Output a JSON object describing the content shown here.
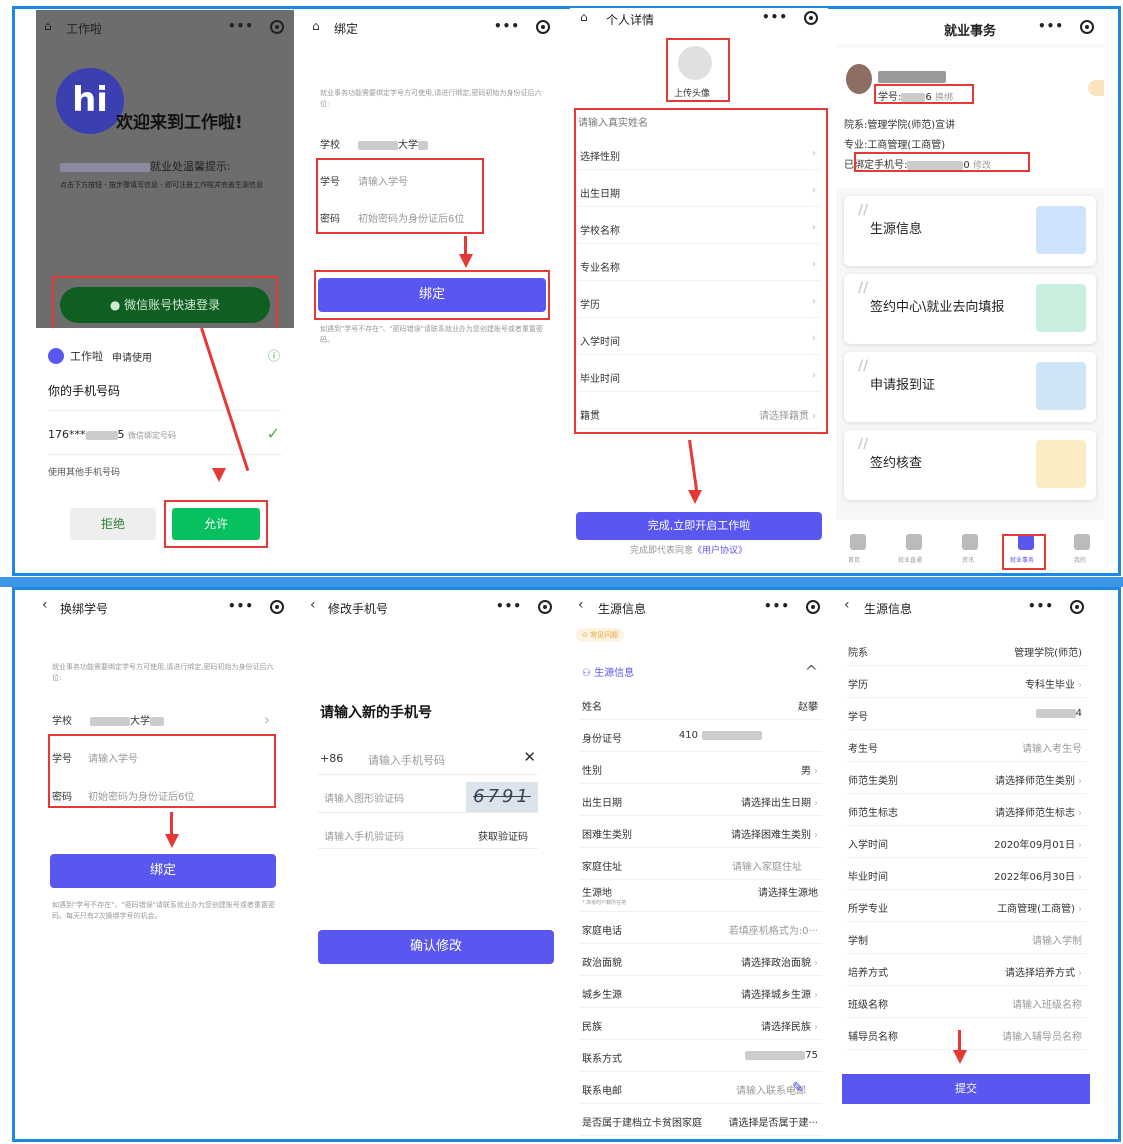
{
  "p1": {
    "header_title": "工作啦",
    "welcome": "欢迎来到工作啦!",
    "hi_logo": "hi",
    "notice_label": "就业处温馨提示:",
    "notice_text": "点击下方按钮 - 按步骤填写信息 - 即可注册工作啦并完善生源信息",
    "wechat_login": "微信账号快速登录",
    "sheet_app": "工作啦",
    "sheet_apply": "申请使用",
    "phone_question": "你的手机号码",
    "phone_masked": "176***",
    "phone_tail": "5",
    "phone_bound": "微信绑定号码",
    "other_phone": "使用其他手机号码",
    "reject": "拒绝",
    "allow": "允许"
  },
  "p2": {
    "header_title": "绑定",
    "desc": "就业事务功能需要绑定学号方可使用,请进行绑定,密码初始为身份证后六位:",
    "school_label": "学校",
    "school_value": "大学",
    "id_label": "学号",
    "id_placeholder": "请输入学号",
    "pwd_label": "密码",
    "pwd_placeholder": "初始密码为身份证后6位",
    "bind_button": "绑定",
    "hint": "如遇到\"学号不存在\"、\"密码错误\"请联系就业办为您创建账号或者重置密码。"
  },
  "p3": {
    "header_title": "个人详情",
    "upload_avatar": "上传头像",
    "name_placeholder": "请输入真实姓名",
    "rows": [
      {
        "k": "选择性别",
        "v": ""
      },
      {
        "k": "出生日期",
        "v": ""
      },
      {
        "k": "学校名称",
        "v": ""
      },
      {
        "k": "专业名称",
        "v": ""
      },
      {
        "k": "学历",
        "v": ""
      },
      {
        "k": "入学时间",
        "v": ""
      },
      {
        "k": "毕业时间",
        "v": ""
      },
      {
        "k": "籍贯",
        "v": "请选择籍贯"
      }
    ],
    "finish_button": "完成,立即开启工作啦",
    "agreement_prefix": "完成即代表同意",
    "agreement_link": "《用户协议》"
  },
  "p4": {
    "header_title": "就业事务",
    "student_no_label": "学号:",
    "student_no_tail": "6",
    "unbind": "换绑",
    "dept": "院系:管理学院(师范)宣讲",
    "major": "专业:工商管理(工商管)",
    "phone_label": "已绑定手机号:",
    "phone_tail": "0",
    "edit": "修改",
    "cards": [
      "生源信息",
      "签约中心\\就业去向填报",
      "申请报到证",
      "签约核查"
    ],
    "nav": [
      "首页",
      "就业直通",
      "资讯",
      "就业事务",
      "我的"
    ]
  },
  "p5": {
    "header_title": "换绑学号",
    "desc": "就业事务功能需要绑定学号方可使用,请进行绑定,密码初始为身份证后六位:",
    "school_label": "学校",
    "school_value": "大学",
    "id_label": "学号",
    "id_placeholder": "请输入学号",
    "pwd_label": "密码",
    "pwd_placeholder": "初始密码为身份证后6位",
    "bind_button": "绑定",
    "hint": "如遇到\"学号不存在\"、\"密码错误\"请联系就业办为您创建账号或者重置密码。每天只有2次换绑学号的机会。"
  },
  "p6": {
    "header_title": "修改手机号",
    "heading": "请输入新的手机号",
    "country_code": "+86",
    "phone_placeholder": "请输入手机号码",
    "captcha_placeholder": "请输入图形验证码",
    "captcha_text": "6791",
    "sms_placeholder": "请输入手机验证码",
    "get_code": "获取验证码",
    "confirm": "确认修改"
  },
  "p7": {
    "header_title": "生源信息",
    "faq": "常见问题",
    "section": "生源信息",
    "rows": [
      {
        "k": "姓名",
        "v": "赵攀"
      },
      {
        "k": "身份证号",
        "v": "410"
      },
      {
        "k": "性别",
        "v": "男"
      },
      {
        "k": "出生日期",
        "v": "请选择出生日期"
      },
      {
        "k": "困难生类别",
        "v": "请选择困难生类别"
      },
      {
        "k": "家庭住址",
        "v": "请输入家庭住址"
      },
      {
        "k": "生源地",
        "v": "请选择生源地"
      },
      {
        "k": "家庭电话",
        "v": "若填座机格式为:0···"
      },
      {
        "k": "政治面貌",
        "v": "请选择政治面貌"
      },
      {
        "k": "城乡生源",
        "v": "请选择城乡生源"
      },
      {
        "k": "民族",
        "v": "请选择民族"
      },
      {
        "k": "联系方式",
        "v": "75"
      },
      {
        "k": "联系电邮",
        "v": "请输入联系电邮"
      },
      {
        "k": "是否属于建档立卡贫困家庭",
        "v": "请选择是否属于建···"
      }
    ],
    "origin_note": "* 高考时户籍所在地"
  },
  "p8": {
    "header_title": "生源信息",
    "rows": [
      {
        "k": "院系",
        "v": "管理学院(师范)"
      },
      {
        "k": "学历",
        "v": "专科生毕业"
      },
      {
        "k": "学号",
        "v": "4"
      },
      {
        "k": "考生号",
        "v": "请输入考生号"
      },
      {
        "k": "师范生类别",
        "v": "请选择师范生类别"
      },
      {
        "k": "师范生标志",
        "v": "请选择师范生标志"
      },
      {
        "k": "入学时间",
        "v": "2020年09月01日"
      },
      {
        "k": "毕业时间",
        "v": "2022年06月30日"
      },
      {
        "k": "所学专业",
        "v": "工商管理(工商管)"
      },
      {
        "k": "学制",
        "v": "请输入学制"
      },
      {
        "k": "培养方式",
        "v": "请选择培养方式"
      },
      {
        "k": "班级名称",
        "v": "请输入班级名称"
      },
      {
        "k": "辅导员名称",
        "v": "请输入辅导员名称"
      }
    ],
    "submit": "提交"
  }
}
